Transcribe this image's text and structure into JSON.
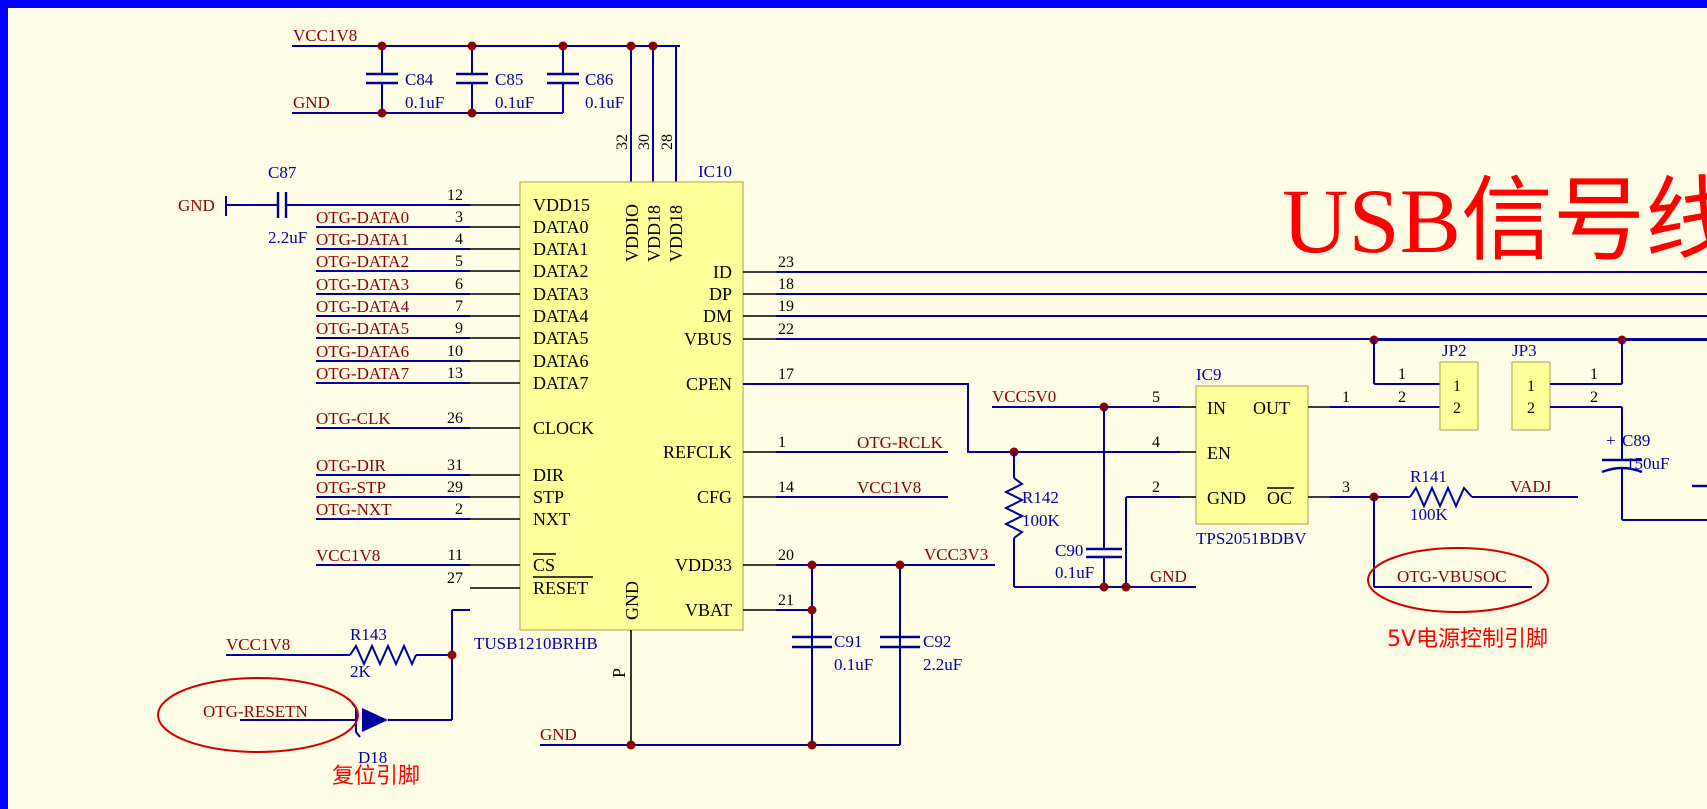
{
  "title": "USB信号线",
  "annotations": {
    "power_control": "5V电源控制引脚",
    "reset": "复位引脚"
  },
  "colors": {
    "border": "#0000ff",
    "sheet": "#fffde6",
    "wire": "#0000a0",
    "net_label": "#8b0000",
    "chip_fill": "#ffff99",
    "highlight": "#ff0000"
  },
  "ic10": {
    "ref": "IC10",
    "part": "TUSB1210BRHB",
    "top_pins": [
      {
        "num": "32",
        "name": "VDDIO"
      },
      {
        "num": "30",
        "name": "VDD18"
      },
      {
        "num": "28",
        "name": "VDD18"
      }
    ],
    "left_pins": [
      {
        "num": "12",
        "name": "VDD15",
        "net": ""
      },
      {
        "num": "3",
        "name": "DATA0",
        "net": "OTG-DATA0"
      },
      {
        "num": "4",
        "name": "DATA1",
        "net": "OTG-DATA1"
      },
      {
        "num": "5",
        "name": "DATA2",
        "net": "OTG-DATA2"
      },
      {
        "num": "6",
        "name": "DATA3",
        "net": "OTG-DATA3"
      },
      {
        "num": "7",
        "name": "DATA4",
        "net": "OTG-DATA4"
      },
      {
        "num": "9",
        "name": "DATA5",
        "net": "OTG-DATA5"
      },
      {
        "num": "10",
        "name": "DATA6",
        "net": "OTG-DATA6"
      },
      {
        "num": "13",
        "name": "DATA7",
        "net": "OTG-DATA7"
      },
      {
        "num": "26",
        "name": "CLOCK",
        "net": "OTG-CLK"
      },
      {
        "num": "31",
        "name": "DIR",
        "net": "OTG-DIR"
      },
      {
        "num": "29",
        "name": "STP",
        "net": "OTG-STP"
      },
      {
        "num": "2",
        "name": "NXT",
        "net": "OTG-NXT"
      },
      {
        "num": "11",
        "name": "CS",
        "net": "VCC1V8"
      },
      {
        "num": "27",
        "name": "RESET",
        "net": ""
      }
    ],
    "right_pins": [
      {
        "num": "23",
        "name": "ID",
        "net": ""
      },
      {
        "num": "18",
        "name": "DP",
        "net": ""
      },
      {
        "num": "19",
        "name": "DM",
        "net": ""
      },
      {
        "num": "22",
        "name": "VBUS",
        "net": ""
      },
      {
        "num": "17",
        "name": "CPEN",
        "net": ""
      },
      {
        "num": "1",
        "name": "REFCLK",
        "net": "OTG-RCLK"
      },
      {
        "num": "14",
        "name": "CFG",
        "net": "VCC1V8"
      },
      {
        "num": "20",
        "name": "VDD33",
        "net": "VCC3V3"
      },
      {
        "num": "21",
        "name": "VBAT",
        "net": ""
      }
    ],
    "bottom_pins": [
      {
        "name": "GND"
      },
      {
        "name": "P"
      }
    ]
  },
  "ic9": {
    "ref": "IC9",
    "part": "TPS2051BDBV",
    "pins": [
      {
        "num": "5",
        "name": "IN"
      },
      {
        "num": "4",
        "name": "EN"
      },
      {
        "num": "2",
        "name": "GND"
      },
      {
        "num": "1",
        "name": "OUT"
      },
      {
        "num": "3",
        "name": "OC"
      }
    ]
  },
  "top_caps": [
    {
      "ref": "C84",
      "value": "0.1uF"
    },
    {
      "ref": "C85",
      "value": "0.1uF"
    },
    {
      "ref": "C86",
      "value": "0.1uF"
    }
  ],
  "c87": {
    "ref": "C87",
    "value": "2.2uF"
  },
  "c90": {
    "ref": "C90",
    "value": "0.1uF"
  },
  "c91": {
    "ref": "C91",
    "value": "0.1uF"
  },
  "c92": {
    "ref": "C92",
    "value": "2.2uF"
  },
  "c89": {
    "ref": "C89",
    "value": "150uF",
    "plus": "+"
  },
  "r141": {
    "ref": "R141",
    "value": "100K"
  },
  "r142": {
    "ref": "R142",
    "value": "100K"
  },
  "r143": {
    "ref": "R143",
    "value": "2K"
  },
  "d18": {
    "ref": "D18"
  },
  "jp2": {
    "ref": "JP2",
    "pin1": "1",
    "pin2": "2",
    "ext1": "1",
    "ext2": "2"
  },
  "jp3": {
    "ref": "JP3",
    "pin1": "1",
    "pin2": "2",
    "ext1": "1",
    "ext2": "2"
  },
  "nets": {
    "vcc1v8": "VCC1V8",
    "gnd": "GND",
    "vcc5v0": "VCC5V0",
    "vcc3v3": "VCC3V3",
    "vadj": "VADJ",
    "otg_rclk": "OTG-RCLK",
    "otg_vbusoc": "OTG-VBUSOC",
    "otg_resetn": "OTG-RESETN"
  }
}
